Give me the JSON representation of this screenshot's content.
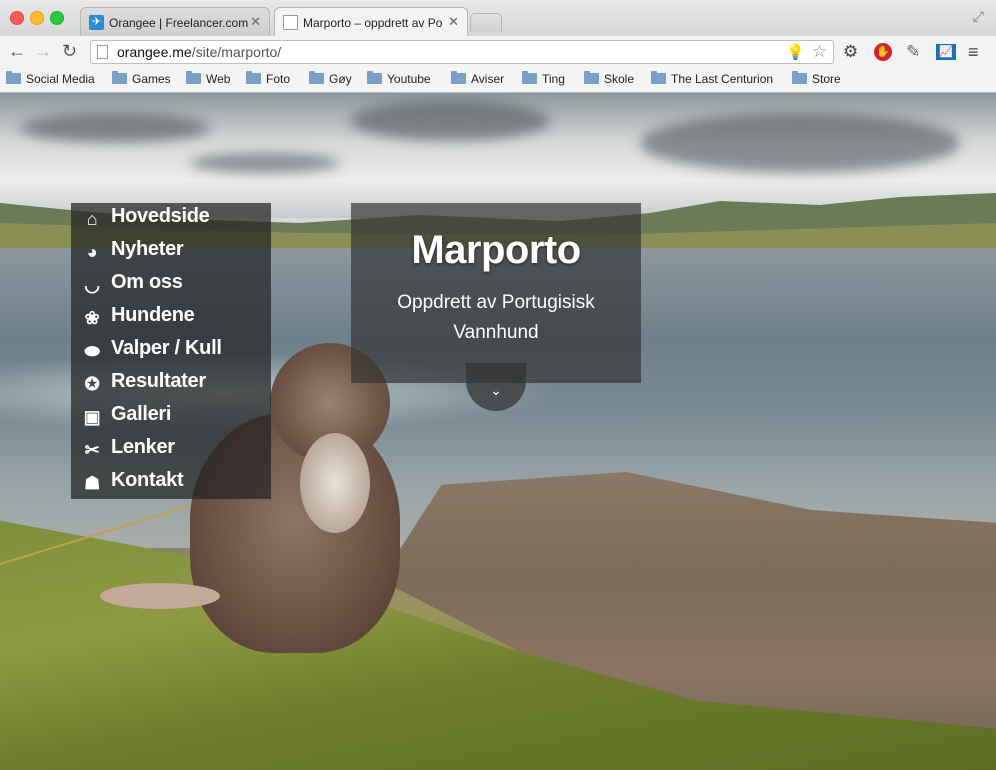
{
  "browser": {
    "tabs": [
      {
        "title": "Orangee | Freelancer.com",
        "icon": "freelancer-bird-icon"
      },
      {
        "title": "Marporto – oppdrett av Por",
        "icon": "page-icon"
      }
    ],
    "url_host": "orangee.me",
    "url_path": "/site/marporto/",
    "bookmarks": [
      "Social Media",
      "Games",
      "Web",
      "Foto",
      "Gøy",
      "Youtube",
      "Aviser",
      "Ting",
      "Skole",
      "The Last Centurion",
      "Store"
    ]
  },
  "site": {
    "nav": [
      {
        "label": "Hovedside",
        "icon": "home-icon"
      },
      {
        "label": "Nyheter",
        "icon": "globe-icon"
      },
      {
        "label": "Om oss",
        "icon": "bowl-icon"
      },
      {
        "label": "Hundene",
        "icon": "paw-icon"
      },
      {
        "label": "Valper / Kull",
        "icon": "bed-icon"
      },
      {
        "label": "Resultater",
        "icon": "rosette-icon"
      },
      {
        "label": "Galleri",
        "icon": "picture-icon"
      },
      {
        "label": "Lenker",
        "icon": "link-icon"
      },
      {
        "label": "Kontakt",
        "icon": "contact-icon"
      }
    ],
    "hero": {
      "title": "Marporto",
      "subtitle": "Oppdrett av Portugisisk Vannhund"
    }
  }
}
